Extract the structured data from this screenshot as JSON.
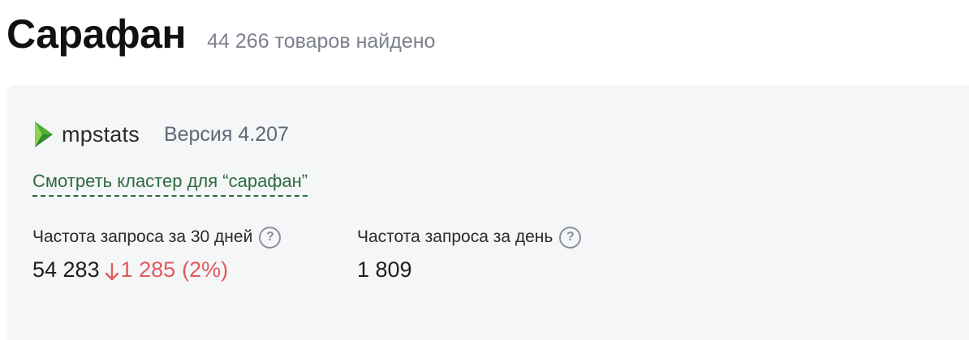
{
  "header": {
    "title": "Сарафан",
    "found_count": "44 266 товаров найдено"
  },
  "widget": {
    "brand": "mpstats",
    "version": "Версия 4.207",
    "cluster_link": "Смотреть кластер для “сарафан”",
    "stats": [
      {
        "label": "Частота запроса за 30 дней",
        "value": "54 283",
        "change": "1 285",
        "change_percent": "(2%)",
        "change_direction": "down"
      },
      {
        "label": "Частота запроса за день",
        "value": "1 809"
      }
    ],
    "help_icon_glyph": "?"
  },
  "colors": {
    "brand_green": "#4caf34",
    "link_green": "#2d6a3e",
    "negative_red": "#e05a5a",
    "panel_bg": "#f5f6f8"
  },
  "icons": {
    "logo": "mpstats-logo-icon",
    "help": "question-circle-icon",
    "trend": "arrow-down-icon"
  }
}
